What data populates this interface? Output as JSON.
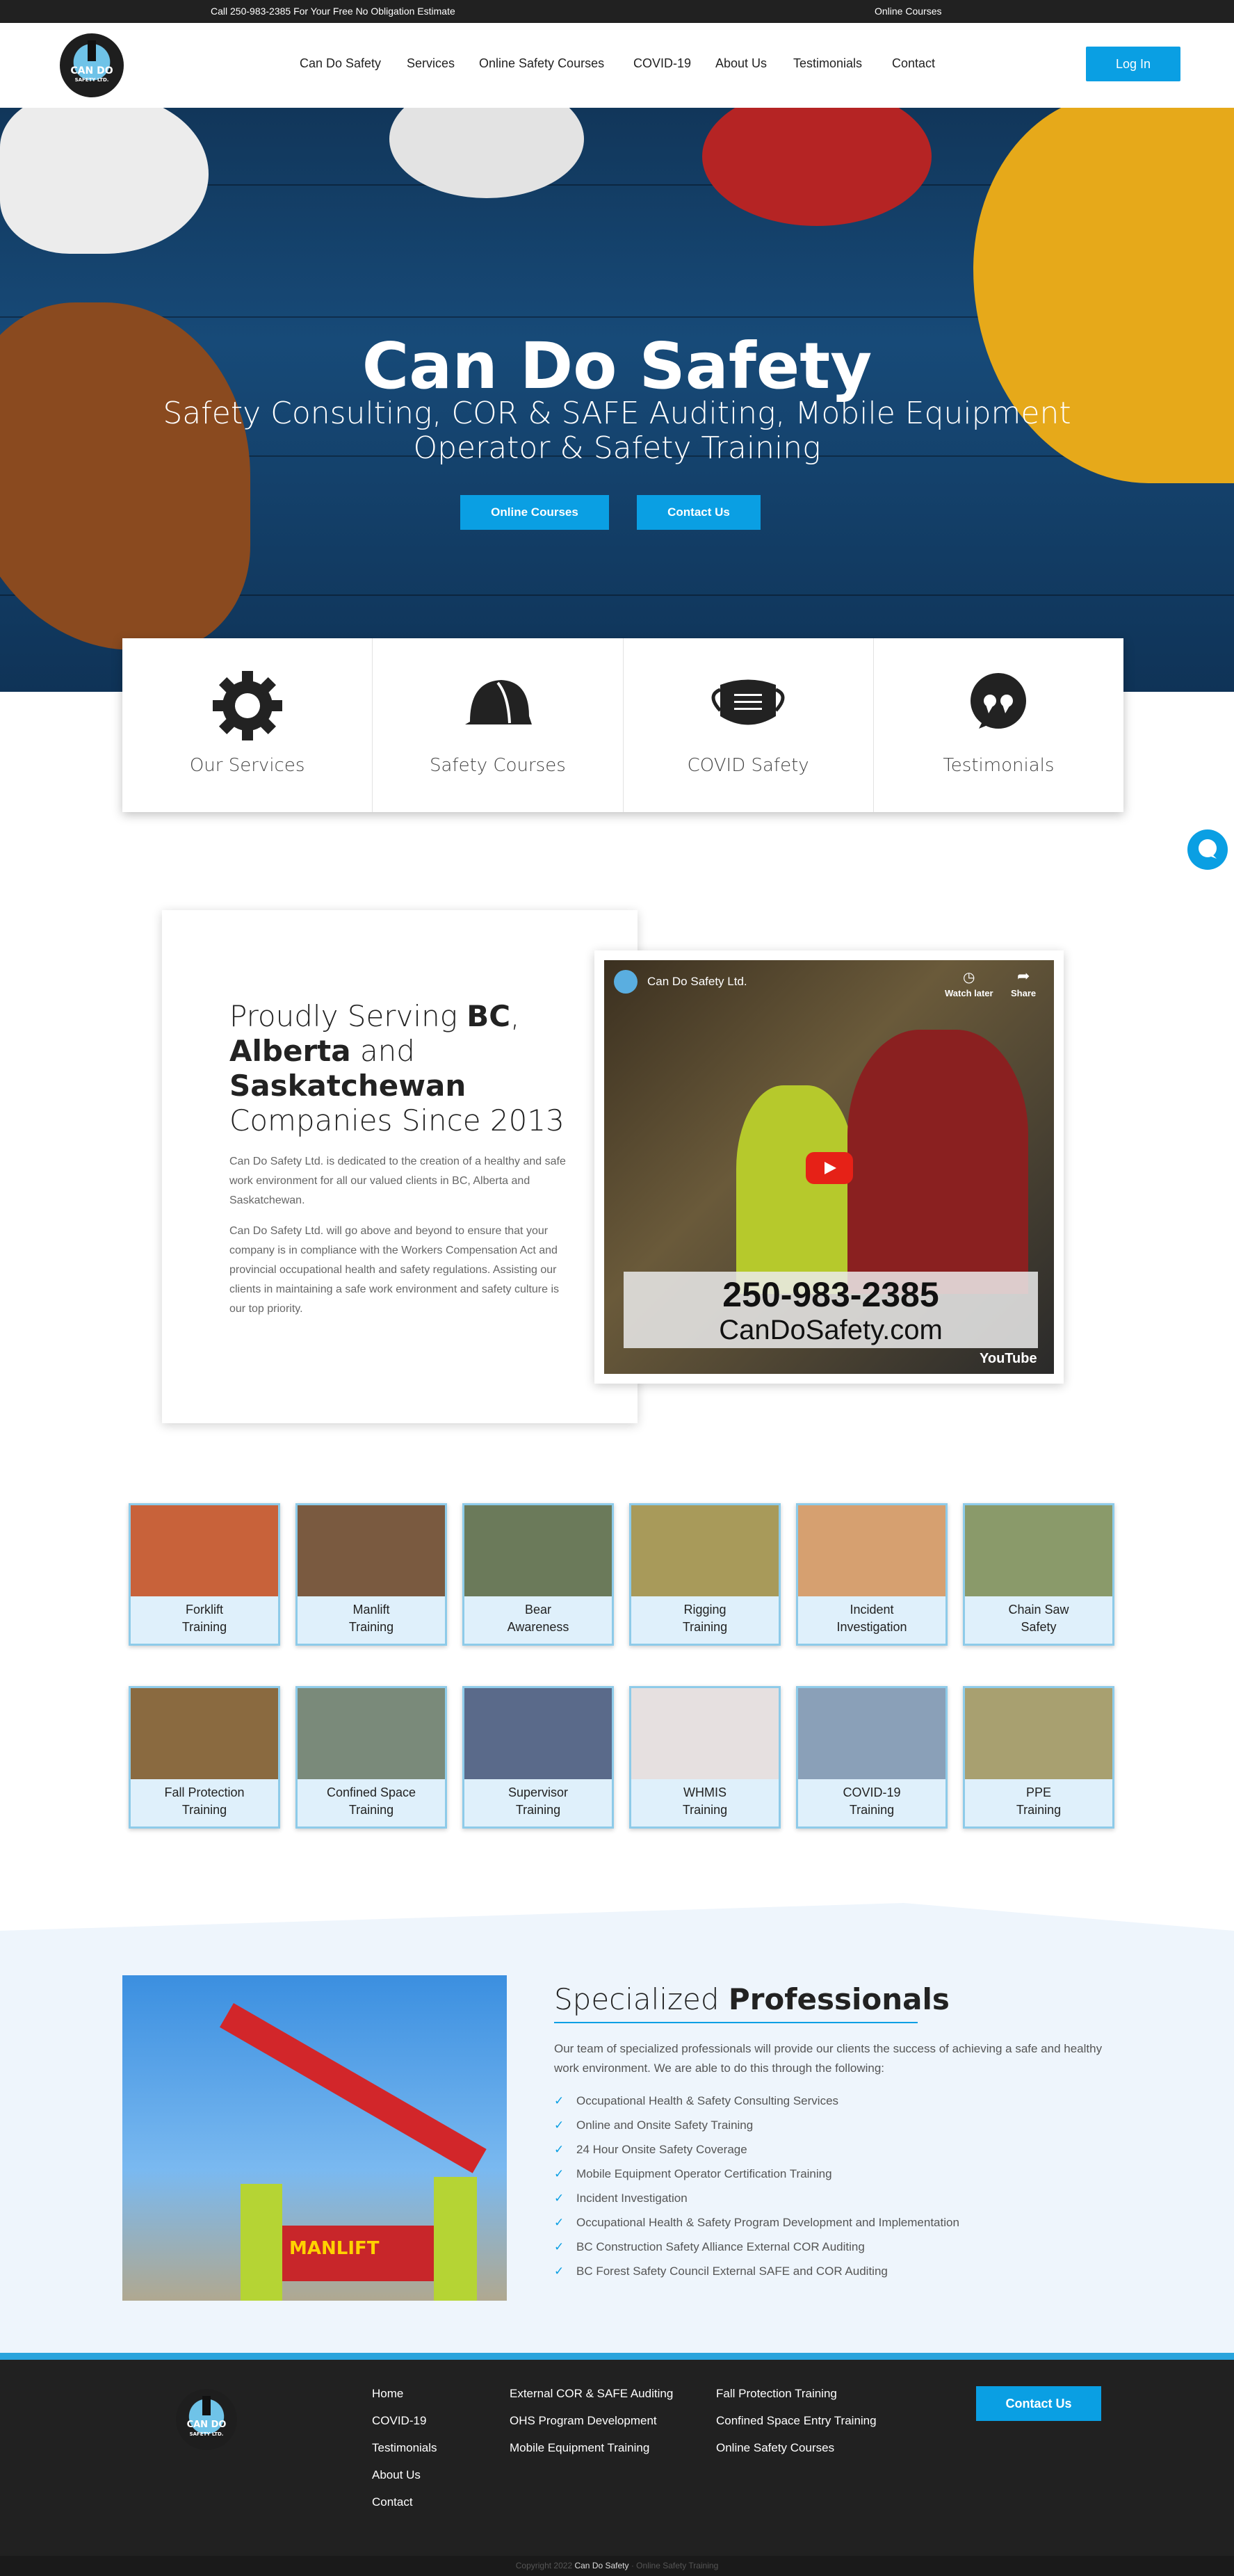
{
  "topbar": {
    "phone_text": "Call 250-983-2385 For Your Free No Obligation Estimate",
    "courses_link": "Online Courses"
  },
  "logo": {
    "line1": "CAN DO",
    "line2": "SAFETY LTD."
  },
  "nav": {
    "items": [
      "Can Do Safety",
      "Services",
      "Online Safety Courses",
      "COVID-19",
      "About Us",
      "Testimonials",
      "Contact"
    ],
    "login": "Log In"
  },
  "hero": {
    "title": "Can Do Safety",
    "subtitle": "Safety Consulting, COR & SAFE Auditing, Mobile Equipment Operator & Safety Training",
    "btn_courses": "Online Courses",
    "btn_contact": "Contact Us"
  },
  "cards": [
    {
      "label": "Our Services",
      "icon": "gear-icon"
    },
    {
      "label": "Safety Courses",
      "icon": "hardhat-icon"
    },
    {
      "label": "COVID Safety",
      "icon": "mask-icon"
    },
    {
      "label": "Testimonials",
      "icon": "quote-icon"
    }
  ],
  "about": {
    "h_pre": "Proudly Serving ",
    "h_bc": "BC",
    "h_comma": ",",
    "h_ab": "Alberta",
    "h_and": " and",
    "h_sk": "Saskatchewan",
    "h_post": "Companies Since 2013",
    "p1": "Can Do Safety Ltd. is dedicated to the creation of a healthy and safe work environment for all our valued clients in BC, Alberta and Saskatchewan.",
    "p2": "Can Do Safety Ltd. will go above and beyond to ensure that your company is in compliance with the Workers Compensation Act and provincial occupational health and safety regulations. Assisting our clients in maintaining a safe work environment and safety culture is our top priority."
  },
  "video": {
    "channel": "Can Do Safety Ltd.",
    "watch_later": "Watch later",
    "share": "Share",
    "phone": "250-983-2385",
    "site": "CanDoSafety.com",
    "youtube": "YouTube"
  },
  "training_row1": [
    {
      "l1": "Forklift",
      "l2": "Training",
      "color": "#c8623a"
    },
    {
      "l1": "Manlift",
      "l2": "Training",
      "color": "#7a5a40"
    },
    {
      "l1": "Bear",
      "l2": "Awareness",
      "color": "#6b7a5a"
    },
    {
      "l1": "Rigging",
      "l2": "Training",
      "color": "#a89a5a"
    },
    {
      "l1": "Incident",
      "l2": "Investigation",
      "color": "#d6a070"
    },
    {
      "l1": "Chain Saw",
      "l2": "Safety",
      "color": "#8a9a6a"
    }
  ],
  "training_row2": [
    {
      "l1": "Fall Protection",
      "l2": "Training",
      "color": "#8a6a40"
    },
    {
      "l1": "Confined Space",
      "l2": "Training",
      "color": "#7a8a7a"
    },
    {
      "l1": "Supervisor",
      "l2": "Training",
      "color": "#5a6a8a"
    },
    {
      "l1": "WHMIS",
      "l2": "Training",
      "color": "#e6e0e0"
    },
    {
      "l1": "COVID-19",
      "l2": "Training",
      "color": "#8aa0b8"
    },
    {
      "l1": "PPE",
      "l2": "Training",
      "color": "#a8a070"
    }
  ],
  "specialized": {
    "h_pre": "Specialized ",
    "h_bold": "Professionals",
    "intro": "Our team of specialized professionals will provide our clients the success of achieving a safe and healthy work environment. We are able to do this through the following:",
    "check": "✓",
    "items": [
      "Occupational Health & Safety Consulting Services",
      "Online and Onsite Safety Training",
      "24 Hour Onsite Safety Coverage",
      "Mobile Equipment Operator Certification Training",
      "Incident Investigation",
      "Occupational Health & Safety Program Development and Implementation",
      "BC Construction Safety Alliance External COR Auditing",
      "BC Forest Safety Council External SAFE and COR Auditing"
    ],
    "manlift_text": "MANLIFT"
  },
  "footer": {
    "col1": [
      "Home",
      "COVID-19",
      "Testimonials",
      "About Us",
      "Contact"
    ],
    "col2": [
      "External COR & SAFE Auditing",
      "OHS Program Development",
      "Mobile Equipment Training"
    ],
    "col3": [
      "Fall Protection Training",
      "Confined Space Entry Training",
      "Online Safety Courses"
    ],
    "contact_btn": "Contact Us",
    "copy_pre": "Copyright 2022 ",
    "copy_brand": "Can Do Safety",
    "copy_post": " · Online Safety Training"
  },
  "colors": {
    "accent": "#0a9fe3",
    "dark": "#212121",
    "tile_bg": "#dff0fb"
  }
}
